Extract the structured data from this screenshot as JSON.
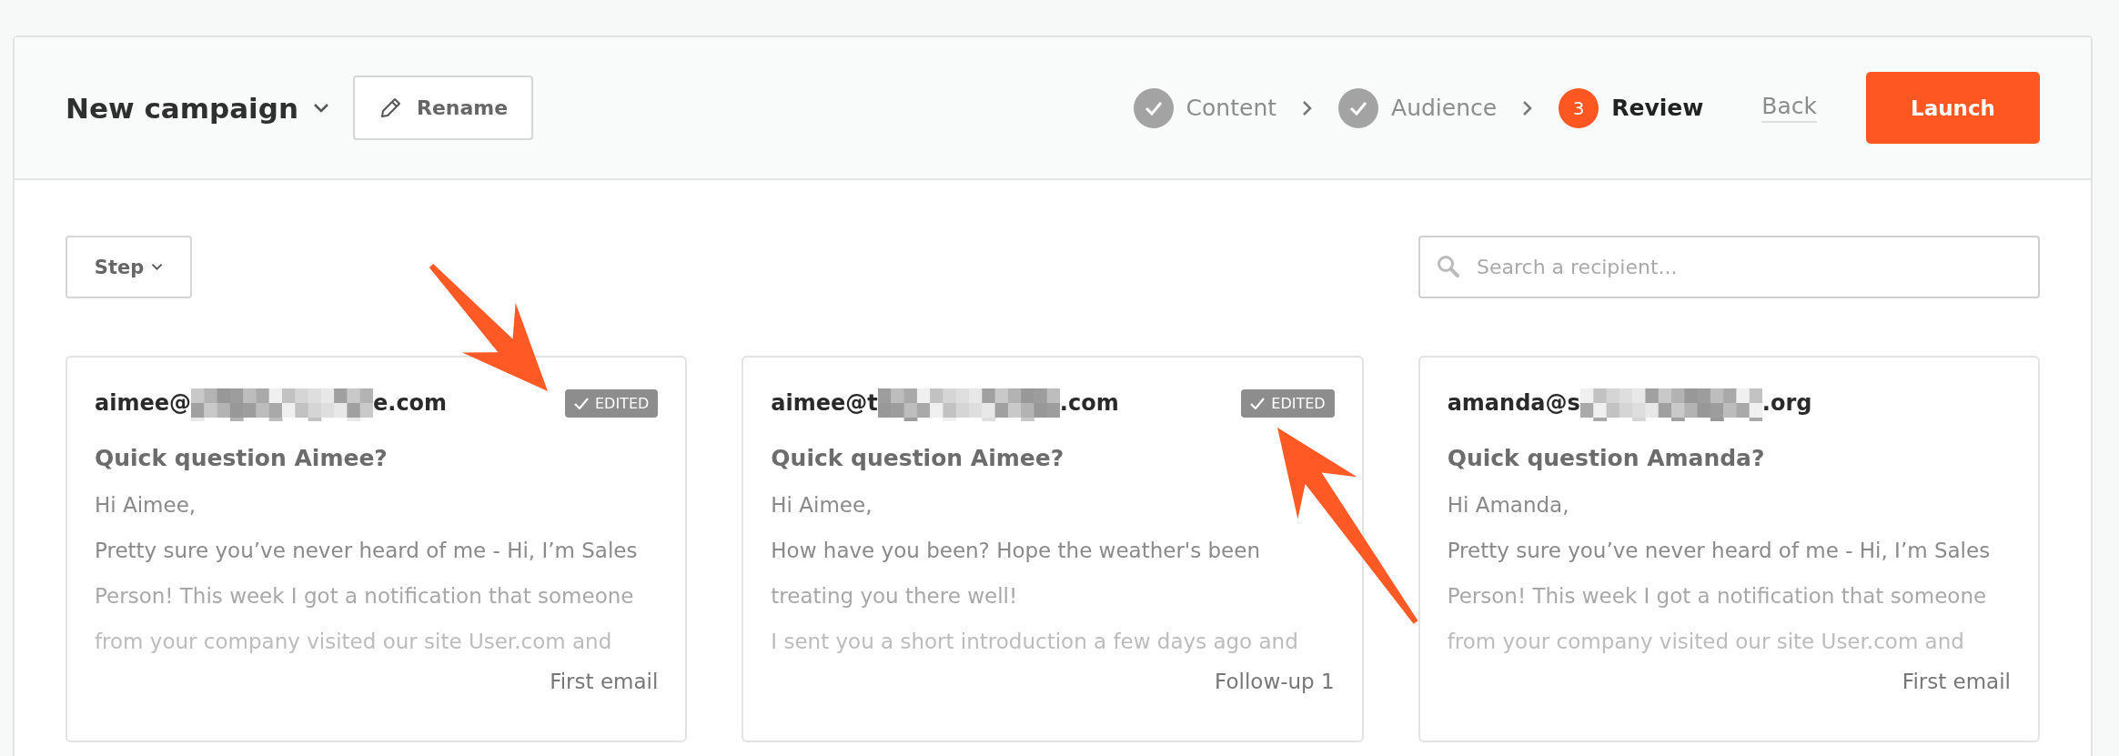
{
  "header": {
    "title": "New campaign",
    "rename_button": "Rename",
    "steps": [
      {
        "label": "Content",
        "completed": true,
        "selected": false
      },
      {
        "label": "Audience",
        "completed": true,
        "selected": false
      },
      {
        "label": "Review",
        "completed": false,
        "selected": true,
        "number": "3"
      }
    ],
    "back_link": "Back",
    "launch_button": "Launch"
  },
  "toolbar": {
    "step_filter": "Step",
    "search": {
      "placeholder": "Search a recipient..."
    }
  },
  "cards": [
    {
      "email_start": "aimee@",
      "email_end": "e.com",
      "redacted": true,
      "edited": true,
      "badge": "EDITED",
      "subject": "Quick question Aimee?",
      "body": [
        "Hi Aimee,",
        "Pretty sure you’ve never heard of me - Hi, I’m Sales",
        "Person! This week I got a notification that someone",
        "from your company visited our site User.com and"
      ],
      "step": "First email"
    },
    {
      "email_start": "aimee@t",
      "email_end": ".com",
      "redacted": true,
      "edited": true,
      "badge": "EDITED",
      "subject": "Quick question Aimee?",
      "body": [
        "Hi Aimee,",
        "How have you been? Hope the weather's been",
        "treating you there well!",
        "I sent you a short introduction a few days ago and"
      ],
      "step": "Follow-up 1"
    },
    {
      "email_start": "amanda@s",
      "email_end": ".org",
      "redacted": true,
      "edited": false,
      "subject": "Quick question Amanda?",
      "body": [
        "Hi Amanda,",
        "Pretty sure you’ve never heard of me - Hi, I’m Sales",
        "Person! This week I got a notification that someone",
        "from your company visited our site User.com and"
      ],
      "step": "First email"
    }
  ]
}
